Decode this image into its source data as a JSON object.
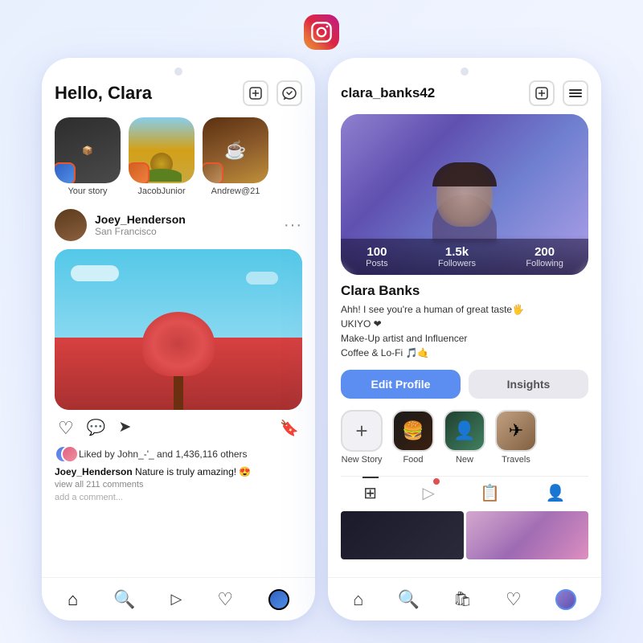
{
  "app": {
    "name": "Instagram"
  },
  "left_phone": {
    "header": {
      "greeting": "Hello, Clara",
      "add_icon": "+",
      "messenger_icon": "✉"
    },
    "stories": [
      {
        "name": "Your story",
        "bg": "dark"
      },
      {
        "name": "JacobJunior",
        "bg": "sunflower"
      },
      {
        "name": "Andrew@21",
        "bg": "coffee"
      }
    ],
    "post": {
      "username": "Joey_Henderson",
      "location": "San Francisco",
      "caption": "Nature is truly amazing! 😍",
      "liked_by": "Liked by John_-'_ and 1,436,116 others",
      "comments": "view all 211 comments",
      "add_comment": "add a comment..."
    },
    "nav": {
      "items": [
        "🏠",
        "🔍",
        "🎬",
        "♡",
        "👤"
      ]
    }
  },
  "right_phone": {
    "header": {
      "username": "clara_banks42",
      "add_icon": "+",
      "menu_icon": "☰"
    },
    "profile": {
      "name": "Clara Banks",
      "bio_line1": "Ahh! I see you're a human of great taste🖐",
      "bio_line2": "UKIYO ❤",
      "bio_line3": "Make-Up artist and Influencer",
      "bio_line4": "Coffee & Lo-Fi 🎵🤙",
      "stats": [
        {
          "number": "100",
          "label": "Posts"
        },
        {
          "number": "1.5k",
          "label": "Followers"
        },
        {
          "number": "200",
          "label": "Following"
        }
      ]
    },
    "buttons": {
      "edit_profile": "Edit Profile",
      "insights": "Insights"
    },
    "highlights": [
      {
        "label": "New Story",
        "type": "add"
      },
      {
        "label": "Food",
        "type": "food"
      },
      {
        "label": "New",
        "type": "new"
      },
      {
        "label": "Travels",
        "type": "travels"
      }
    ],
    "grid_tabs": [
      "⊞",
      "▷",
      "📋",
      "👤"
    ],
    "grid_items": [
      "dark",
      "purple"
    ]
  }
}
